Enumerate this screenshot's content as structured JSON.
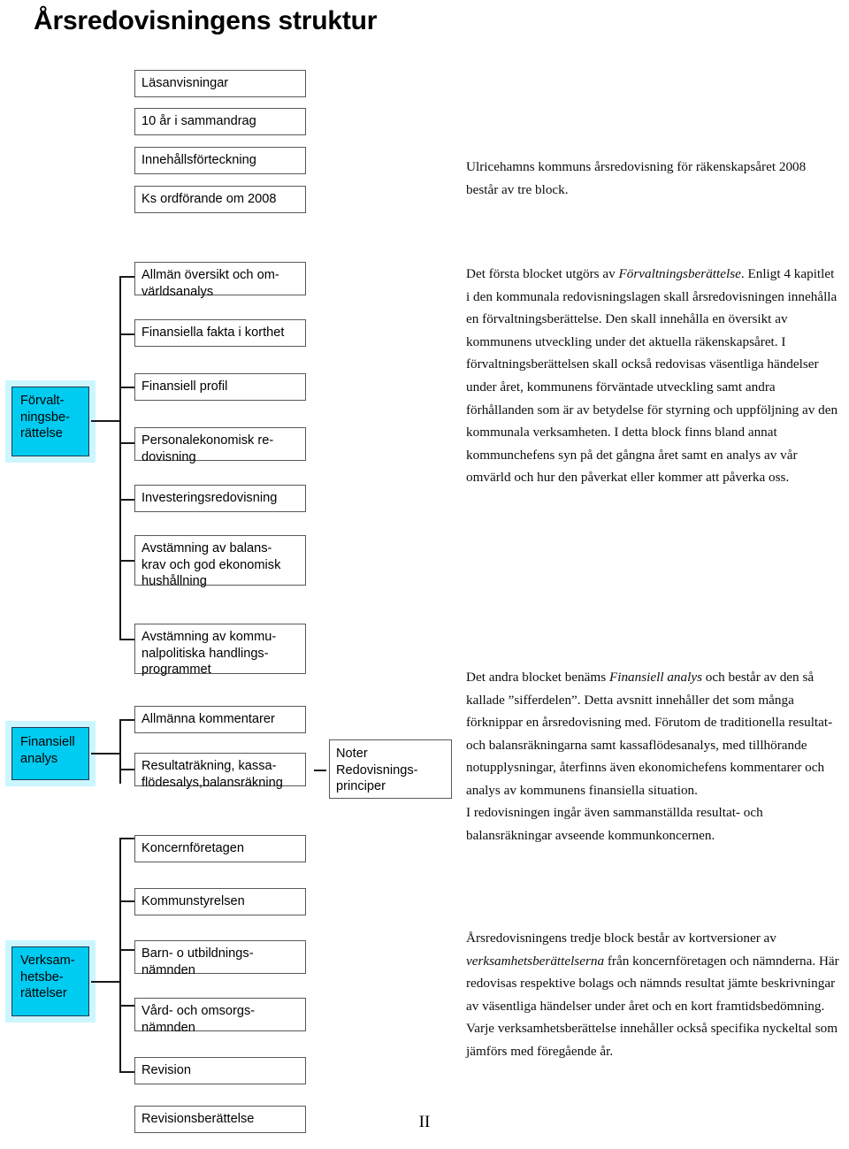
{
  "document": {
    "title": "Årsredovisningens struktur",
    "page_number": "II"
  },
  "top_boxes": [
    {
      "label": "Läsanvisningar"
    },
    {
      "label": "10 år i sammandrag"
    },
    {
      "label": "Innehållsförteckning"
    },
    {
      "label": "Ks ordförande om 2008"
    }
  ],
  "blocks": [
    {
      "key": "forvaltningsberattelse",
      "label": "Förvalt-\nningsbe-\nrättelse",
      "color": "#00CBF0",
      "children": [
        {
          "label": "Allmän översikt och om-\nvärldsanalys"
        },
        {
          "label": "Finansiella fakta i korthet"
        },
        {
          "label": "Finansiell profil"
        },
        {
          "label": "Personalekonomisk re-\ndovisning"
        },
        {
          "label": "Investeringsredovisning"
        },
        {
          "label": "Avstämning av balans-\nkrav och god ekonomisk\nhushållning"
        },
        {
          "label": "Avstämning av kommu-\nnalpolitiska handlings-\nprogrammet"
        }
      ]
    },
    {
      "key": "finansiell_analys",
      "label": "Finansiell\nanalys",
      "color": "#00CBF0",
      "children": [
        {
          "label": "Allmänna kommentarer"
        },
        {
          "label": "Resultaträkning, kassa-\nflödesalys,balansräkning"
        },
        {
          "label": "Koncernföretagen"
        }
      ],
      "side_box": {
        "label": "Noter\nRedovisnings-\nprinciper"
      }
    },
    {
      "key": "verksamhetsberattelser",
      "label": "Verksam-\nhetsbe-\nrättelser",
      "color": "#00CBF0",
      "children": [
        {
          "label": "Kommunstyrelsen"
        },
        {
          "label": "Barn- o utbildnings-\nnämnden"
        },
        {
          "label": "Vård- och omsorgs-\nnämnden"
        },
        {
          "label": "Revision"
        },
        {
          "label": "Revisionsberättelse"
        }
      ]
    }
  ],
  "paragraphs": {
    "intro": "Ulricehamns kommuns årsredovisning för räkenskapsåret 2008 består av tre block.",
    "block1_pre": "Det första blocket utgörs av ",
    "block1_em": "Förvaltningsberättelse",
    "block1_post": ". Enligt 4 kapitlet i den kommunala redovisningslagen skall årsredovisningen innehålla en förvaltningsberättelse. Den skall innehålla en översikt av kommunens utveckling under det aktuella räkenskapsåret. I förvaltningsberättelsen skall också redovisas väsentliga händelser under året, kommunens förväntade utveckling samt andra förhållanden som är av betydelse för styrning och uppföljning av den kommunala verksamheten. I detta block finns bland annat kommunchefens syn på det gångna året samt en analys av vår omvärld och hur den påverkat eller kommer att påverka oss.",
    "block2_pre": "Det andra blocket benäms ",
    "block2_em": "Finansiell analys",
    "block2_post": " och består av den så kallade ”sifferdelen”. Detta avsnitt innehåller det som många förknippar en årsredovisning med. Förutom de traditionella resultat- och balansräkningarna samt kassaflödesanalys, med tillhörande notupplysningar, återfinns även ekonomichefens kommentarer och analys av kommunens finansiella situation.",
    "block2_extra": "I redovisningen ingår även sammanställda resultat- och balansräkningar avseende kommunkoncernen.",
    "block3_pre": "Årsredovisningens tredje block består av kortversioner av ",
    "block3_em": "verksamhetsberättelserna",
    "block3_post": " från koncernföretagen och nämnderna. Här redovisas respektive bolags och nämnds resultat jämte beskrivningar av väsentliga händelser under året och en kort framtidsbedömning. Varje verksamhetsberättelse innehåller också specifika nyckeltal som jämförs med föregående år."
  }
}
